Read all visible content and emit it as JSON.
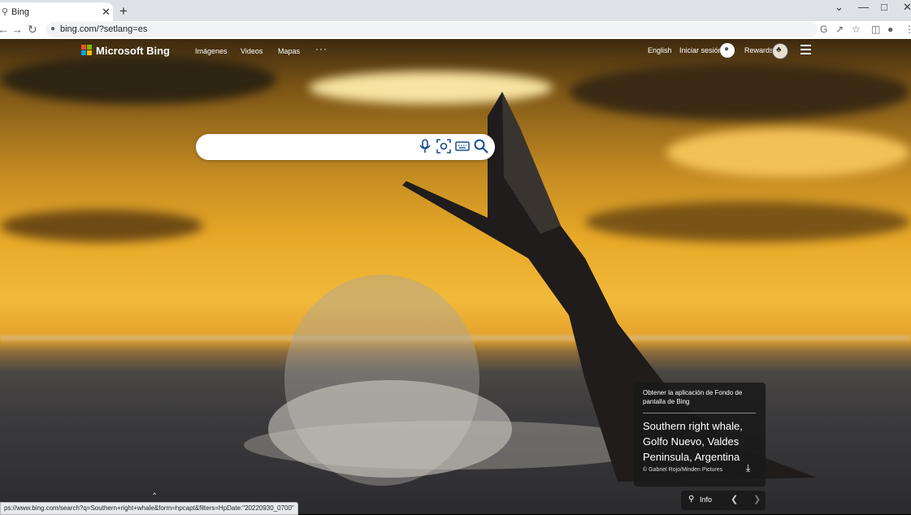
{
  "browser": {
    "tab_title": "Bing",
    "tab_icon": "search-icon",
    "close_glyph": "✕",
    "new_tab_glyph": "+",
    "url": "bing.com/?setlang=es",
    "status_url": "ps://www.bing.com/search?q=Southern+right+whale&form=hpcapt&filters=HpDate:\"20220930_0700\""
  },
  "header": {
    "logo_text": "Microsoft Bing",
    "nav": [
      "Imágenes",
      "Videos",
      "Mapas"
    ],
    "more_glyph": "···",
    "language": "English",
    "sign_in": "Iniciar sesión",
    "rewards": "Rewards"
  },
  "search": {
    "placeholder": ""
  },
  "image_info": {
    "promo": "Obtener la aplicación de Fondo de pantalla de Bing",
    "title": "Southern right whale, Golfo Nuevo, Valdes Peninsula, Argentina",
    "credit": "© Gabriel Rojo/Minden Pictures",
    "info_label": "Info"
  },
  "colors": {
    "accent": "#0078d4",
    "ms_red": "#f25022",
    "ms_green": "#7fba00",
    "ms_blue": "#00a4ef",
    "ms_yellow": "#ffb900"
  }
}
